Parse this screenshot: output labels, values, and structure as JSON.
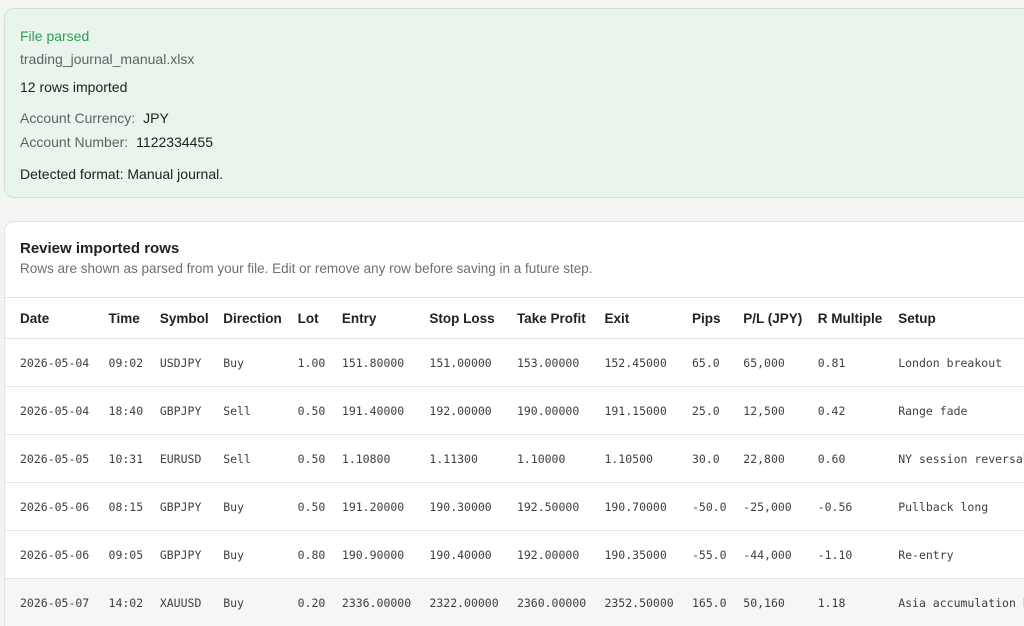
{
  "parsed": {
    "status": "File parsed",
    "filename": "trading_journal_manual.xlsx",
    "rows_imported": "12 rows imported",
    "currency_label": "Account Currency:",
    "currency_value": "JPY",
    "account_label": "Account Number:",
    "account_value": "1122334455",
    "format": "Detected format: Manual journal."
  },
  "review": {
    "title": "Review imported rows",
    "subtitle": "Rows are shown as parsed from your file. Edit or remove any row before saving in a future step.",
    "columns": [
      "Date",
      "Time",
      "Symbol",
      "Direction",
      "Lot",
      "Entry",
      "Stop Loss",
      "Take Profit",
      "Exit",
      "Pips",
      "P/L (JPY)",
      "R Multiple",
      "Setup"
    ],
    "rows": [
      [
        "2026-05-04",
        "09:02",
        "USDJPY",
        "Buy",
        "1.00",
        "151.80000",
        "151.00000",
        "153.00000",
        "152.45000",
        "65.0",
        "65,000",
        "0.81",
        "London breakout"
      ],
      [
        "2026-05-04",
        "18:40",
        "GBPJPY",
        "Sell",
        "0.50",
        "191.40000",
        "192.00000",
        "190.00000",
        "191.15000",
        "25.0",
        "12,500",
        "0.42",
        "Range fade"
      ],
      [
        "2026-05-05",
        "10:31",
        "EURUSD",
        "Sell",
        "0.50",
        "1.10800",
        "1.11300",
        "1.10000",
        "1.10500",
        "30.0",
        "22,800",
        "0.60",
        "NY session reversal"
      ],
      [
        "2026-05-06",
        "08:15",
        "GBPJPY",
        "Buy",
        "0.50",
        "191.20000",
        "190.30000",
        "192.50000",
        "190.70000",
        "-50.0",
        "-25,000",
        "-0.56",
        "Pullback long"
      ],
      [
        "2026-05-06",
        "09:05",
        "GBPJPY",
        "Buy",
        "0.80",
        "190.90000",
        "190.40000",
        "192.00000",
        "190.35000",
        "-55.0",
        "-44,000",
        "-1.10",
        "Re-entry"
      ],
      [
        "2026-05-07",
        "14:02",
        "XAUUSD",
        "Buy",
        "0.20",
        "2336.00000",
        "2322.00000",
        "2360.00000",
        "2352.50000",
        "165.0",
        "50,160",
        "1.18",
        "Asia accumulation b"
      ]
    ]
  },
  "colors": {
    "success_green": "#2f9e57",
    "parsed_background": "#e8f4ec"
  }
}
